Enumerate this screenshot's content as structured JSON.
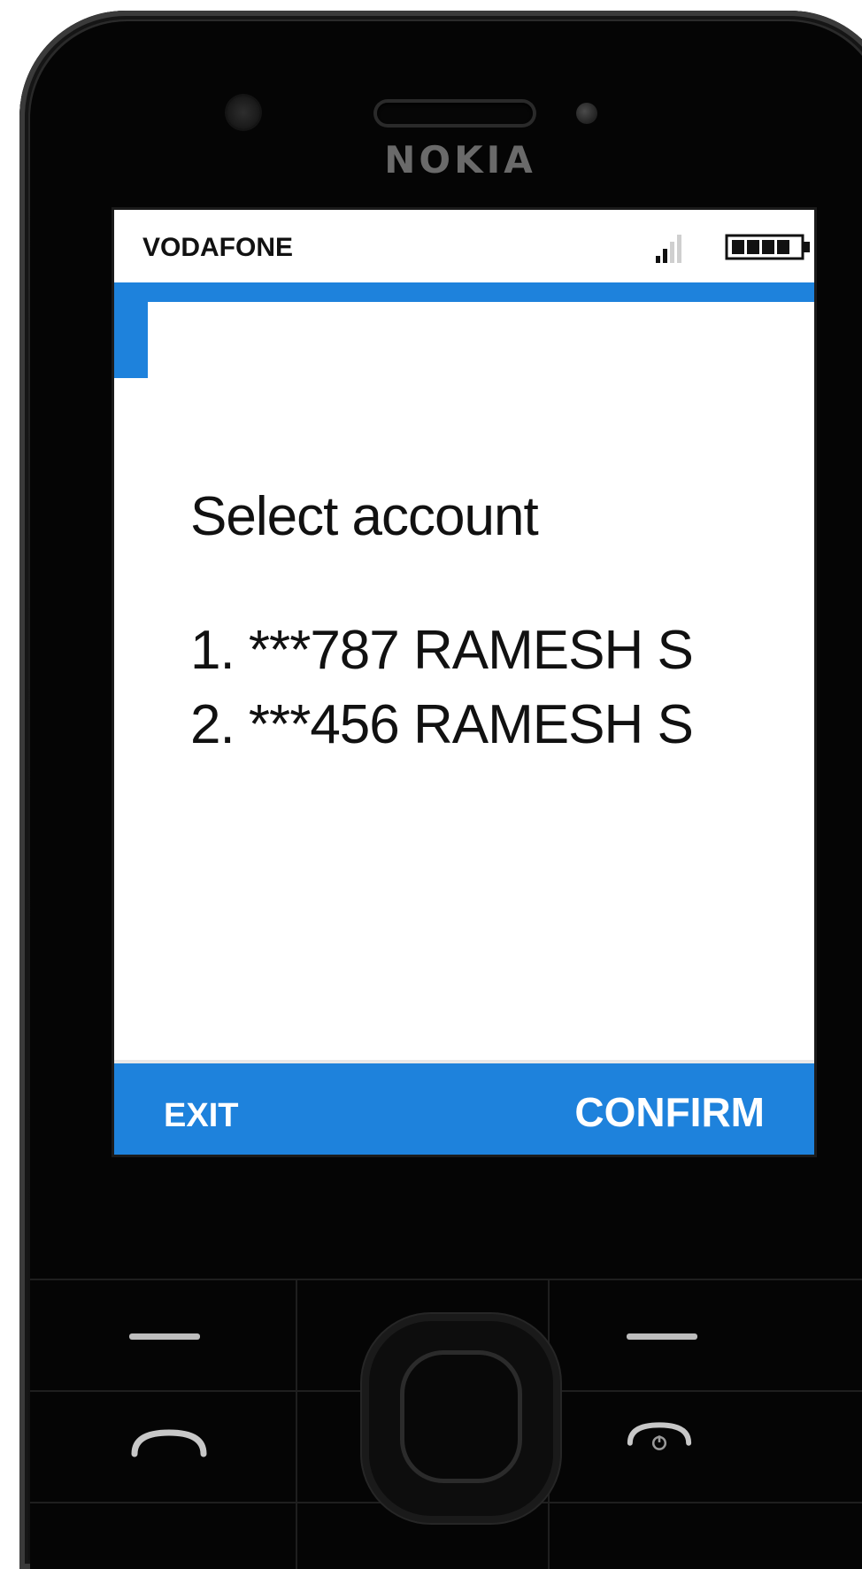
{
  "device": {
    "brand": "NOKIA"
  },
  "status_bar": {
    "operator": "VODAFONE",
    "signal_icon": "signal-strength-icon",
    "battery_icon": "battery-full-icon"
  },
  "screen": {
    "title": "Select account",
    "options": [
      "1. ***787 RAMESH S",
      "2. ***456 RAMESH S"
    ]
  },
  "softkeys": {
    "left": "EXIT",
    "right": "CONFIRM"
  },
  "colors": {
    "accent": "#1e82dc",
    "screen_bg": "#ffffff",
    "phone_body": "#111111"
  }
}
